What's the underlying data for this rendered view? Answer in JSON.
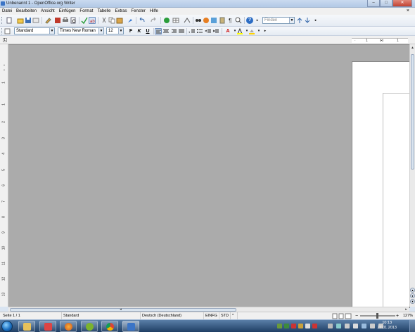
{
  "window": {
    "title": "Unbenannt 1 - OpenOffice.org Writer"
  },
  "menubar": {
    "items": [
      "Datei",
      "Bearbeiten",
      "Ansicht",
      "Einfügen",
      "Format",
      "Tabelle",
      "Extras",
      "Fenster",
      "Hilfe"
    ],
    "close_doc": "×"
  },
  "toolbar1": {
    "find_placeholder": "Finden",
    "help_icon": "?"
  },
  "toolbar2": {
    "style_value": "Standard",
    "font_value": "Times New Roman",
    "size_value": "12",
    "bold_label": "F",
    "italic_label": "K",
    "underline_label": "U"
  },
  "ruler": {
    "h_labels": [
      "1",
      "1",
      "1"
    ],
    "v_labels": [
      "1",
      "1",
      "2",
      "3",
      "4",
      "5",
      "6",
      "7",
      "8",
      "9",
      "10",
      "11",
      "12",
      "13"
    ]
  },
  "statusbar": {
    "page": "Seite 1 / 1",
    "style": "Standard",
    "language": "Deutsch (Deutschland)",
    "insert_mode": "EINFG",
    "selection_mode": "STD",
    "modified": "*",
    "zoom": "127%"
  },
  "taskbar": {
    "time": "10:13",
    "date": "27.01.2013"
  }
}
